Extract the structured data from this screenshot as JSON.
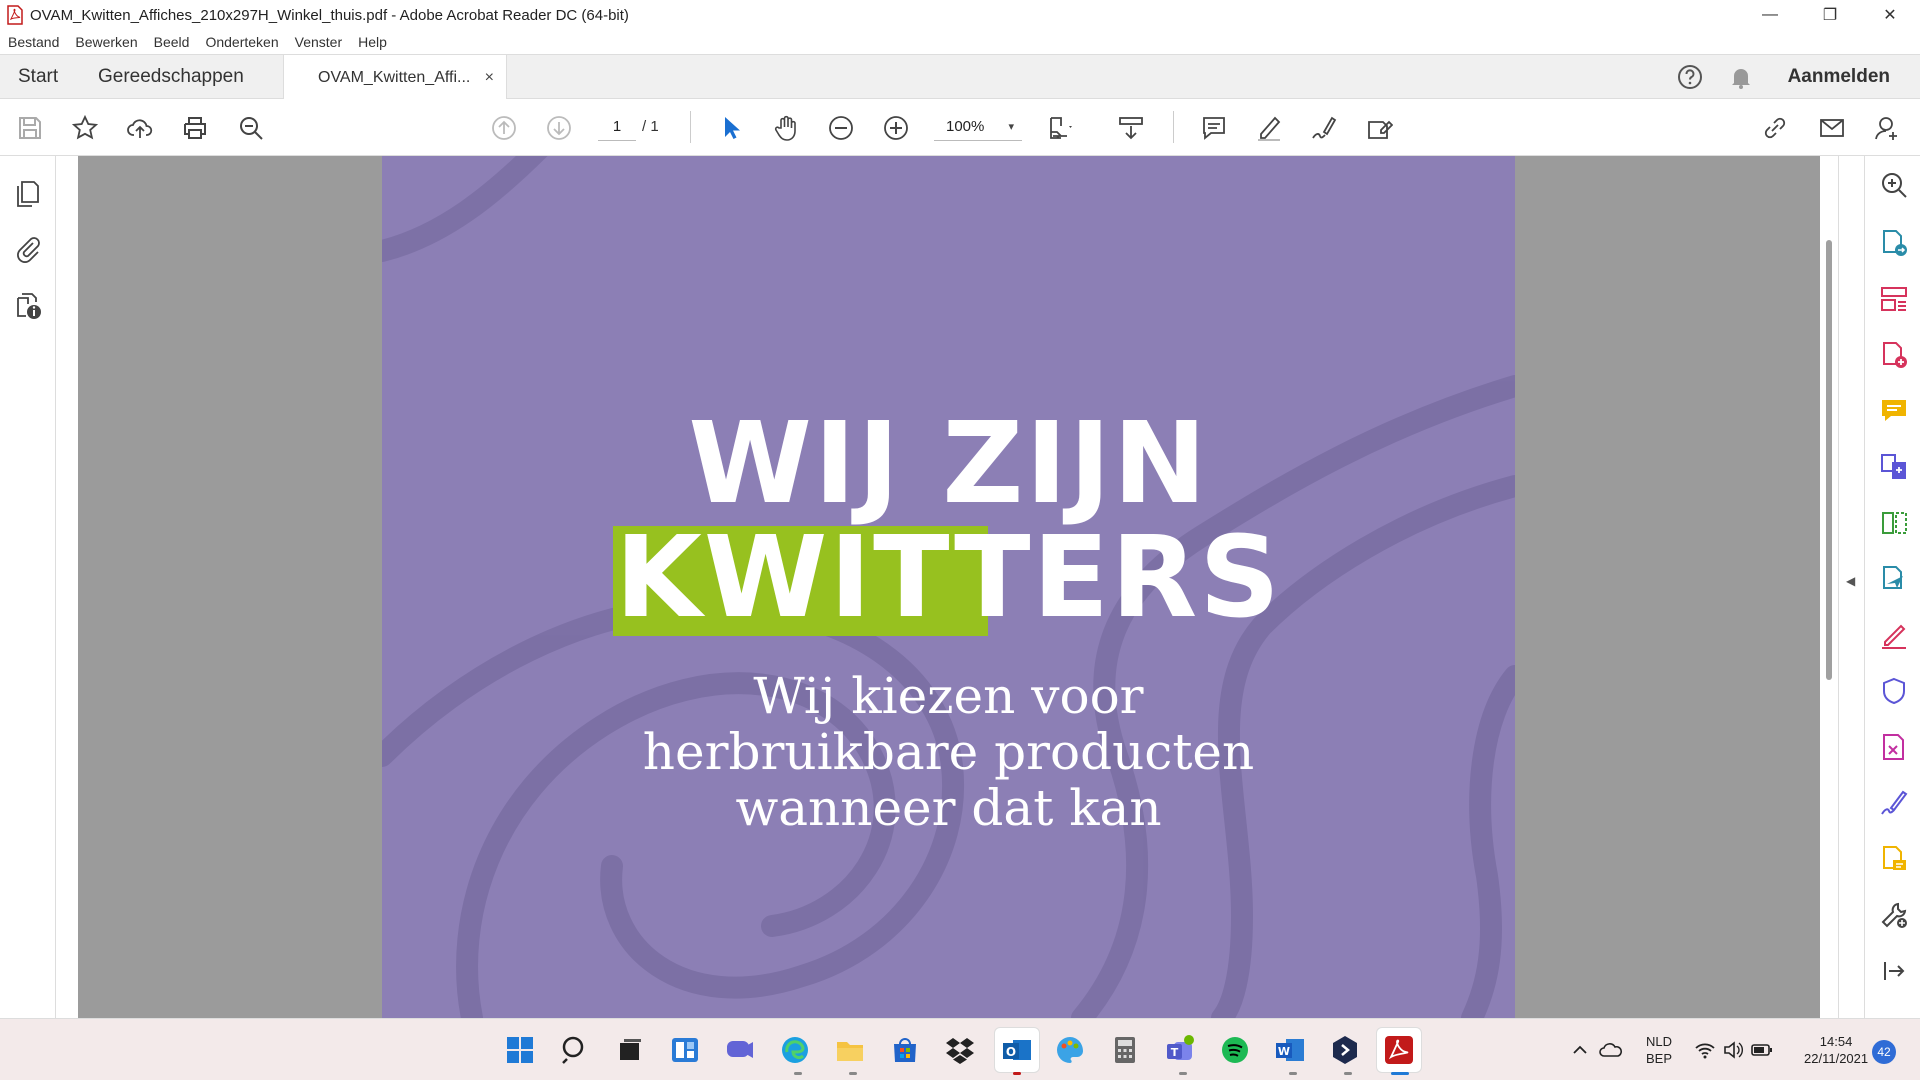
{
  "window": {
    "title": "OVAM_Kwitten_Affiches_210x297H_Winkel_thuis.pdf - Adobe Acrobat Reader DC (64-bit)",
    "minimize": "—",
    "maximize": "❐",
    "close": "✕"
  },
  "menu": [
    "Bestand",
    "Bewerken",
    "Beeld",
    "Onderteken",
    "Venster",
    "Help"
  ],
  "tabs": {
    "start": "Start",
    "tools": "Gereedschappen",
    "document": "OVAM_Kwitten_Affi...",
    "document_close": "×"
  },
  "header": {
    "sign_in": "Aanmelden"
  },
  "toolbar": {
    "current_page": "1",
    "total_pages": "/ 1",
    "zoom": "100%",
    "zoom_caret": "▾"
  },
  "document": {
    "headline_line1": "WIJ ZIJN",
    "headline_line2": "KWITTERS",
    "sub_line1": "Wij kiezen voor",
    "sub_line2": "herbruikbare producten",
    "sub_line3": "wanneer dat kan",
    "colors": {
      "page_bg": "#8c7fb5",
      "highlight": "#97c11f",
      "swirl": "#7a6ea3"
    }
  },
  "taskbar": {
    "lang_top": "NLD",
    "lang_bottom": "BEP",
    "time": "14:54",
    "date": "22/11/2021",
    "notifications": "42"
  }
}
